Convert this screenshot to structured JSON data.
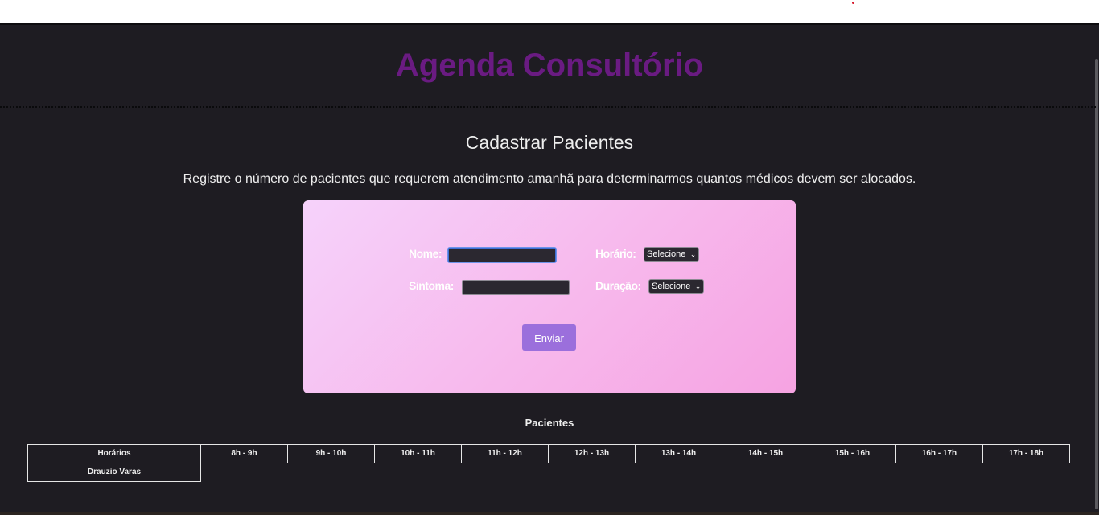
{
  "header": {
    "title": "Agenda Consultório"
  },
  "section": {
    "title": "Cadastrar Pacientes",
    "description": "Registre o número de pacientes que requerem atendimento amanhã para determinarmos quantos médicos devem ser alocados."
  },
  "form": {
    "name_label": "Nome:",
    "name_value": "",
    "symptom_label": "Sintoma:",
    "symptom_value": "",
    "time_label": "Horário:",
    "time_selected": "Selecione",
    "duration_label": "Duração:",
    "duration_selected": "Selecione",
    "submit_label": "Enviar"
  },
  "table": {
    "title": "Pacientes",
    "headers": [
      "Horários",
      "8h - 9h",
      "9h - 10h",
      "10h - 11h",
      "11h - 12h",
      "12h - 13h",
      "13h - 14h",
      "14h - 15h",
      "15h - 16h",
      "16h - 17h",
      "17h - 18h"
    ],
    "rows": [
      [
        "Drauzio Varas"
      ]
    ]
  },
  "colors": {
    "background": "#1e1c22",
    "title": "#6a1b82",
    "card_gradient_start": "#f6d2fb",
    "card_gradient_end": "#f6a3e2",
    "button": "#9b6fdc"
  }
}
